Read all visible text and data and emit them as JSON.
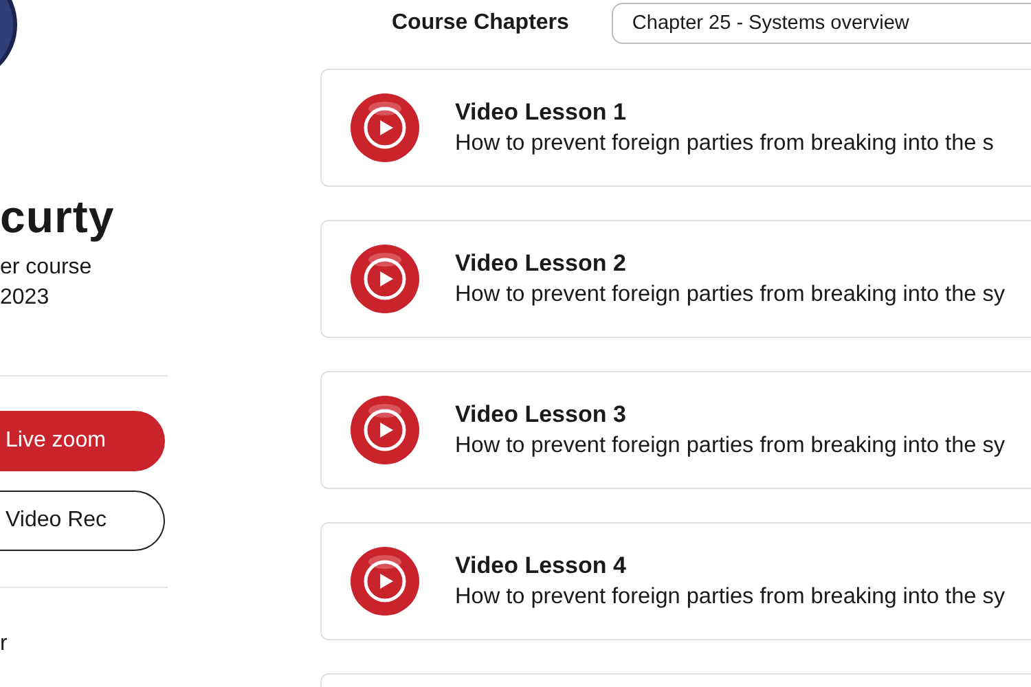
{
  "sidebar": {
    "title": "curty",
    "subtitle_lines": [
      "er course",
      "2023"
    ],
    "buttons": [
      {
        "label": "Live zoom",
        "kind": "primary"
      },
      {
        "label": "Video Rec",
        "kind": "outline"
      }
    ],
    "footer_text": "r"
  },
  "chapters": {
    "label": "Course Chapters",
    "chapter_select": {
      "value": "Chapter 25 - Systems overview"
    }
  },
  "lessons": [
    {
      "title": "Video Lesson 1",
      "description": "How to prevent foreign parties from breaking into the s"
    },
    {
      "title": "Video Lesson 2",
      "description": "How to prevent foreign parties from breaking into the sy"
    },
    {
      "title": "Video Lesson 3",
      "description": "How to prevent foreign parties from breaking into the sy"
    },
    {
      "title": "Video Lesson 4",
      "description": "How to prevent foreign parties from breaking into the sy"
    }
  ]
}
